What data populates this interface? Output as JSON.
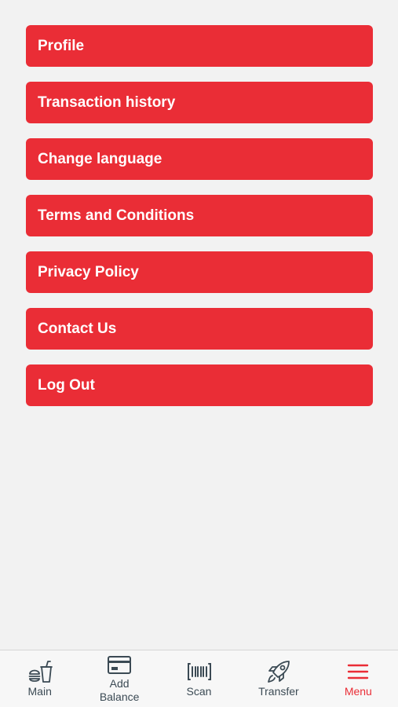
{
  "menu": {
    "items": [
      {
        "label": "Profile"
      },
      {
        "label": "Transaction history"
      },
      {
        "label": "Change language"
      },
      {
        "label": "Terms and Conditions"
      },
      {
        "label": "Privacy Policy"
      },
      {
        "label": "Contact Us"
      },
      {
        "label": "Log Out"
      }
    ]
  },
  "tabbar": {
    "tabs": [
      {
        "label": "Main",
        "icon": "food-icon"
      },
      {
        "label": "Add\nBalance",
        "icon": "card-icon"
      },
      {
        "label": "Scan",
        "icon": "barcode-icon"
      },
      {
        "label": "Transfer",
        "icon": "rocket-icon"
      },
      {
        "label": "Menu",
        "icon": "hamburger-icon",
        "active": true
      }
    ]
  },
  "colors": {
    "accent": "#ea2d36",
    "background": "#f2f2f2",
    "tab_text": "#3b4a54"
  }
}
